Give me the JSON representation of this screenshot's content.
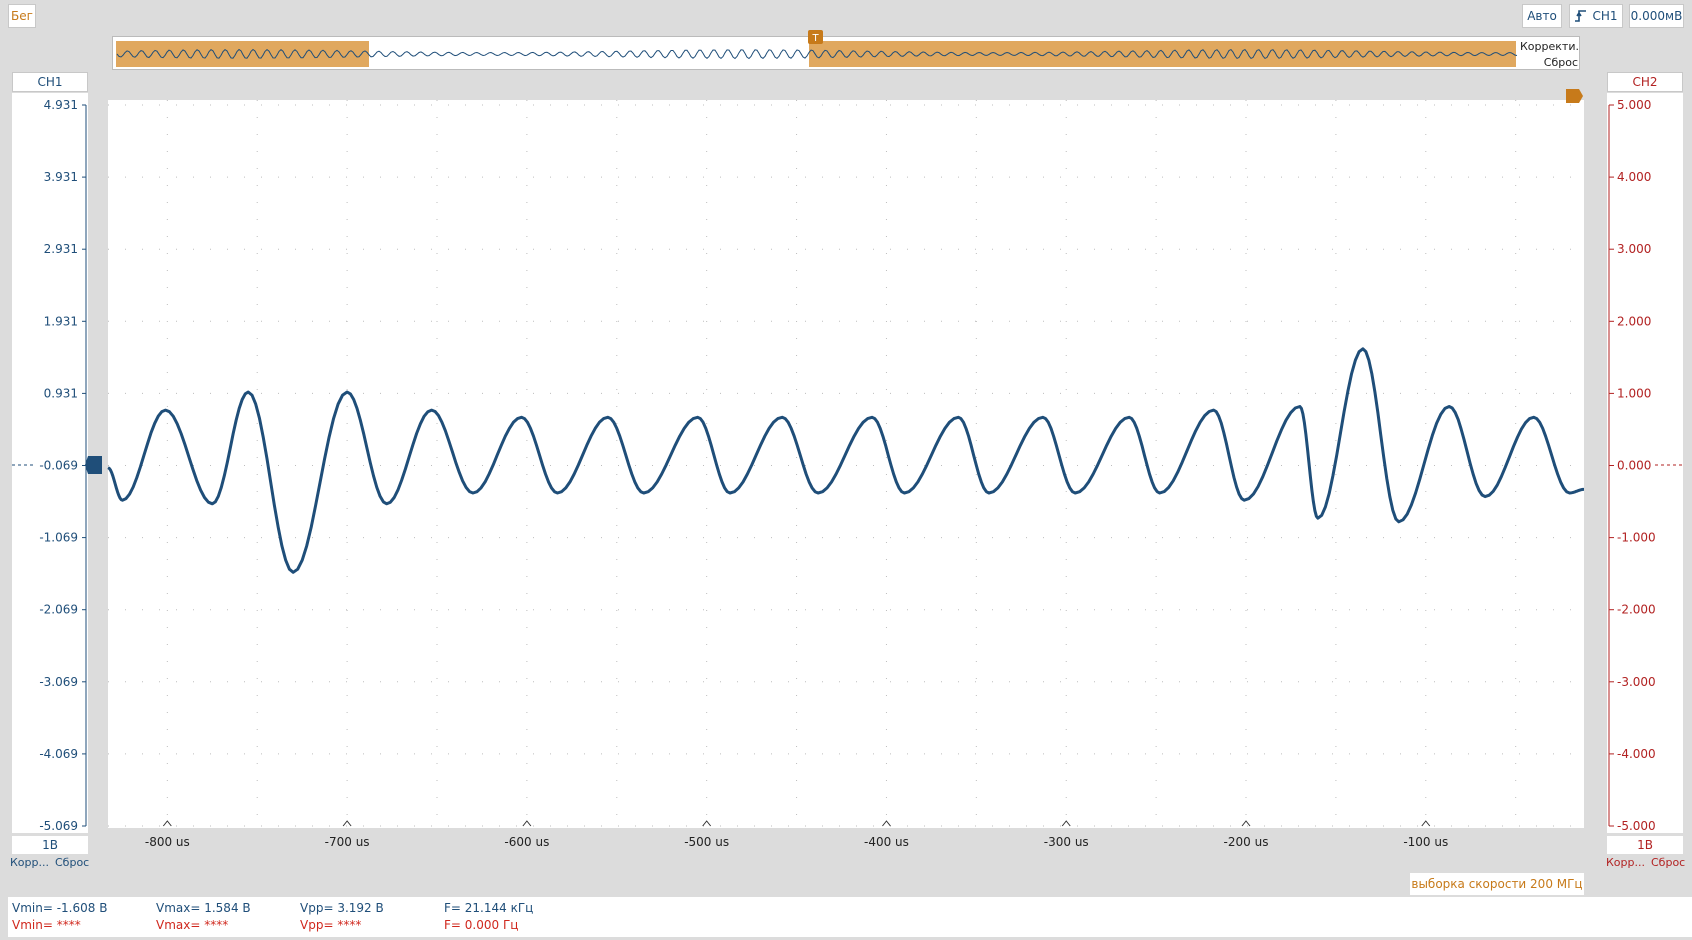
{
  "toolbar": {
    "run_label": "Бег",
    "mode_label": "Авто",
    "trigger_source": "CH1",
    "trigger_level": "0.000мВ",
    "trigger_marker": "T"
  },
  "overview": {
    "correct_label": "Корректи...",
    "reset_label": "Сброс"
  },
  "channels": {
    "ch1": {
      "name": "CH1",
      "scale": "1В",
      "correct_label": "Корр...",
      "reset_label": "Сброс",
      "color": "#1f4e79"
    },
    "ch2": {
      "name": "CH2",
      "scale": "1В",
      "correct_label": "Корр...",
      "reset_label": "Сброс",
      "color": "#b22222"
    }
  },
  "sample_rate_label": "выборка скорости 200 МГц",
  "measurements": {
    "ch1": {
      "vmin": "Vmin= -1.608 В",
      "vmax": "Vmax= 1.584 В",
      "vpp": "Vpp= 3.192 В",
      "freq": "F= 21.144 кГц"
    },
    "ch2": {
      "vmin": "Vmin= ****",
      "vmax": "Vmax= ****",
      "vpp": "Vpp= ****",
      "freq": "F= 0.000 Гц"
    }
  },
  "chart_data": {
    "type": "line",
    "title": "",
    "xlabel": "",
    "ylabel": "",
    "x_ticks": [
      "-800 us",
      "-700 us",
      "-600 us",
      "-500 us",
      "-400 us",
      "-300 us",
      "-200 us",
      "-100 us"
    ],
    "x_tick_values": [
      -800,
      -700,
      -600,
      -500,
      -400,
      -300,
      -200,
      -100
    ],
    "xlim": [
      -833,
      -12
    ],
    "y_left_ticks": [
      "4.931",
      "3.931",
      "2.931",
      "1.931",
      "0.931",
      "-0.069",
      "-1.069",
      "-2.069",
      "-3.069",
      "-4.069",
      "-5.069"
    ],
    "y_left_range": [
      -5.069,
      4.931
    ],
    "y_right_ticks": [
      "5.000",
      "4.000",
      "3.000",
      "2.000",
      "1.000",
      "0.000",
      "-1.000",
      "-2.000",
      "-3.000",
      "-4.000",
      "-5.000"
    ],
    "y_right_range": [
      -5.0,
      5.0
    ],
    "grid": true,
    "series": [
      {
        "name": "CH1",
        "color": "#1f4e79",
        "x": [
          -833,
          -825,
          -801,
          -775,
          -755,
          -730,
          -700,
          -678,
          -653,
          -630,
          -603,
          -583,
          -555,
          -535,
          -505,
          -487,
          -458,
          -438,
          -408,
          -390,
          -360,
          -343,
          -313,
          -295,
          -265,
          -248,
          -218,
          -201,
          -170,
          -160,
          -135,
          -115,
          -87,
          -67,
          -40,
          -20,
          -12
        ],
        "y": [
          -0.1,
          -0.55,
          0.7,
          -0.6,
          0.95,
          -1.55,
          0.95,
          -0.6,
          0.7,
          -0.45,
          0.6,
          -0.45,
          0.6,
          -0.45,
          0.6,
          -0.45,
          0.6,
          -0.45,
          0.6,
          -0.45,
          0.6,
          -0.45,
          0.6,
          -0.45,
          0.6,
          -0.45,
          0.7,
          -0.55,
          0.75,
          -0.8,
          1.55,
          -0.85,
          0.75,
          -0.5,
          0.6,
          -0.45,
          -0.4
        ]
      }
    ]
  }
}
